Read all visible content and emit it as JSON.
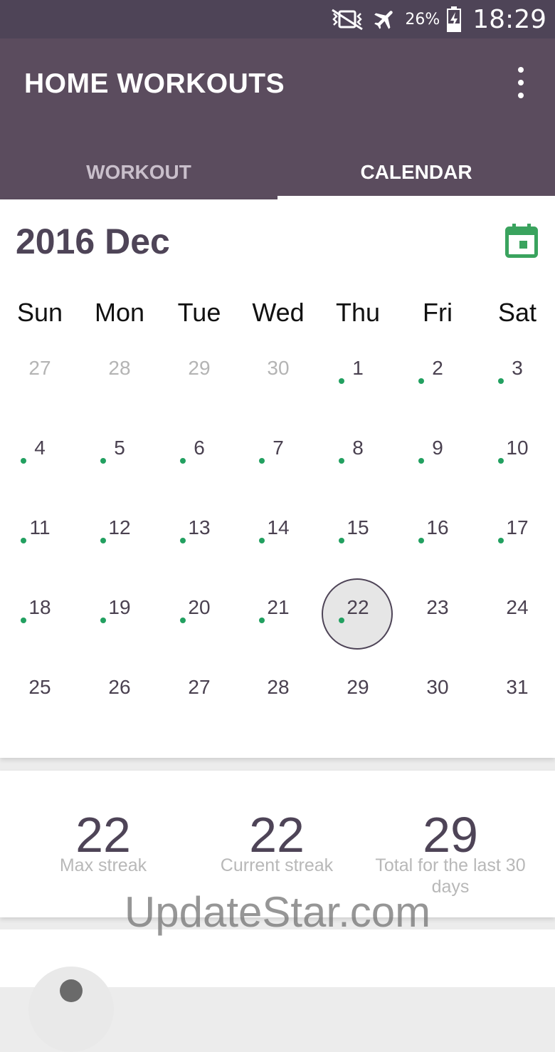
{
  "status_bar": {
    "icons": [
      "mute-vibrate-icon",
      "airplane-icon",
      "battery-charging-icon"
    ],
    "battery_percent": "26%",
    "time": "18:29"
  },
  "app_bar": {
    "title": "HOME WORKOUTS",
    "menu_icon": "overflow-menu-icon"
  },
  "tabs": [
    {
      "label": "WORKOUT",
      "active": false
    },
    {
      "label": "CALENDAR",
      "active": true
    }
  ],
  "calendar": {
    "month_title": "2016 Dec",
    "calendar_icon": "calendar-icon",
    "weekdays": [
      "Sun",
      "Mon",
      "Tue",
      "Wed",
      "Thu",
      "Fri",
      "Sat"
    ],
    "weeks": [
      [
        {
          "d": "27",
          "m": true
        },
        {
          "d": "28",
          "m": true
        },
        {
          "d": "29",
          "m": true
        },
        {
          "d": "30",
          "m": true
        },
        {
          "d": "1",
          "dot": true
        },
        {
          "d": "2",
          "dot": true
        },
        {
          "d": "3",
          "dot": true
        }
      ],
      [
        {
          "d": "4",
          "dot": true
        },
        {
          "d": "5",
          "dot": true
        },
        {
          "d": "6",
          "dot": true
        },
        {
          "d": "7",
          "dot": true
        },
        {
          "d": "8",
          "dot": true
        },
        {
          "d": "9",
          "dot": true
        },
        {
          "d": "10",
          "dot": true
        }
      ],
      [
        {
          "d": "11",
          "dot": true
        },
        {
          "d": "12",
          "dot": true
        },
        {
          "d": "13",
          "dot": true
        },
        {
          "d": "14",
          "dot": true
        },
        {
          "d": "15",
          "dot": true
        },
        {
          "d": "16",
          "dot": true
        },
        {
          "d": "17",
          "dot": true
        }
      ],
      [
        {
          "d": "18",
          "dot": true
        },
        {
          "d": "19",
          "dot": true
        },
        {
          "d": "20",
          "dot": true
        },
        {
          "d": "21",
          "dot": true
        },
        {
          "d": "22",
          "dot": true,
          "today": true
        },
        {
          "d": "23"
        },
        {
          "d": "24"
        }
      ],
      [
        {
          "d": "25"
        },
        {
          "d": "26"
        },
        {
          "d": "27"
        },
        {
          "d": "28"
        },
        {
          "d": "29"
        },
        {
          "d": "30"
        },
        {
          "d": "31"
        }
      ]
    ],
    "colors": {
      "dot": "#22a060",
      "accent": "#4e4457",
      "icon": "#3aa35e"
    }
  },
  "stats": [
    {
      "value": "22",
      "label": "Max streak"
    },
    {
      "value": "22",
      "label": "Current streak"
    },
    {
      "value": "29",
      "label": "Total for the last 30 days"
    }
  ],
  "watermark": "UpdateStar.com"
}
